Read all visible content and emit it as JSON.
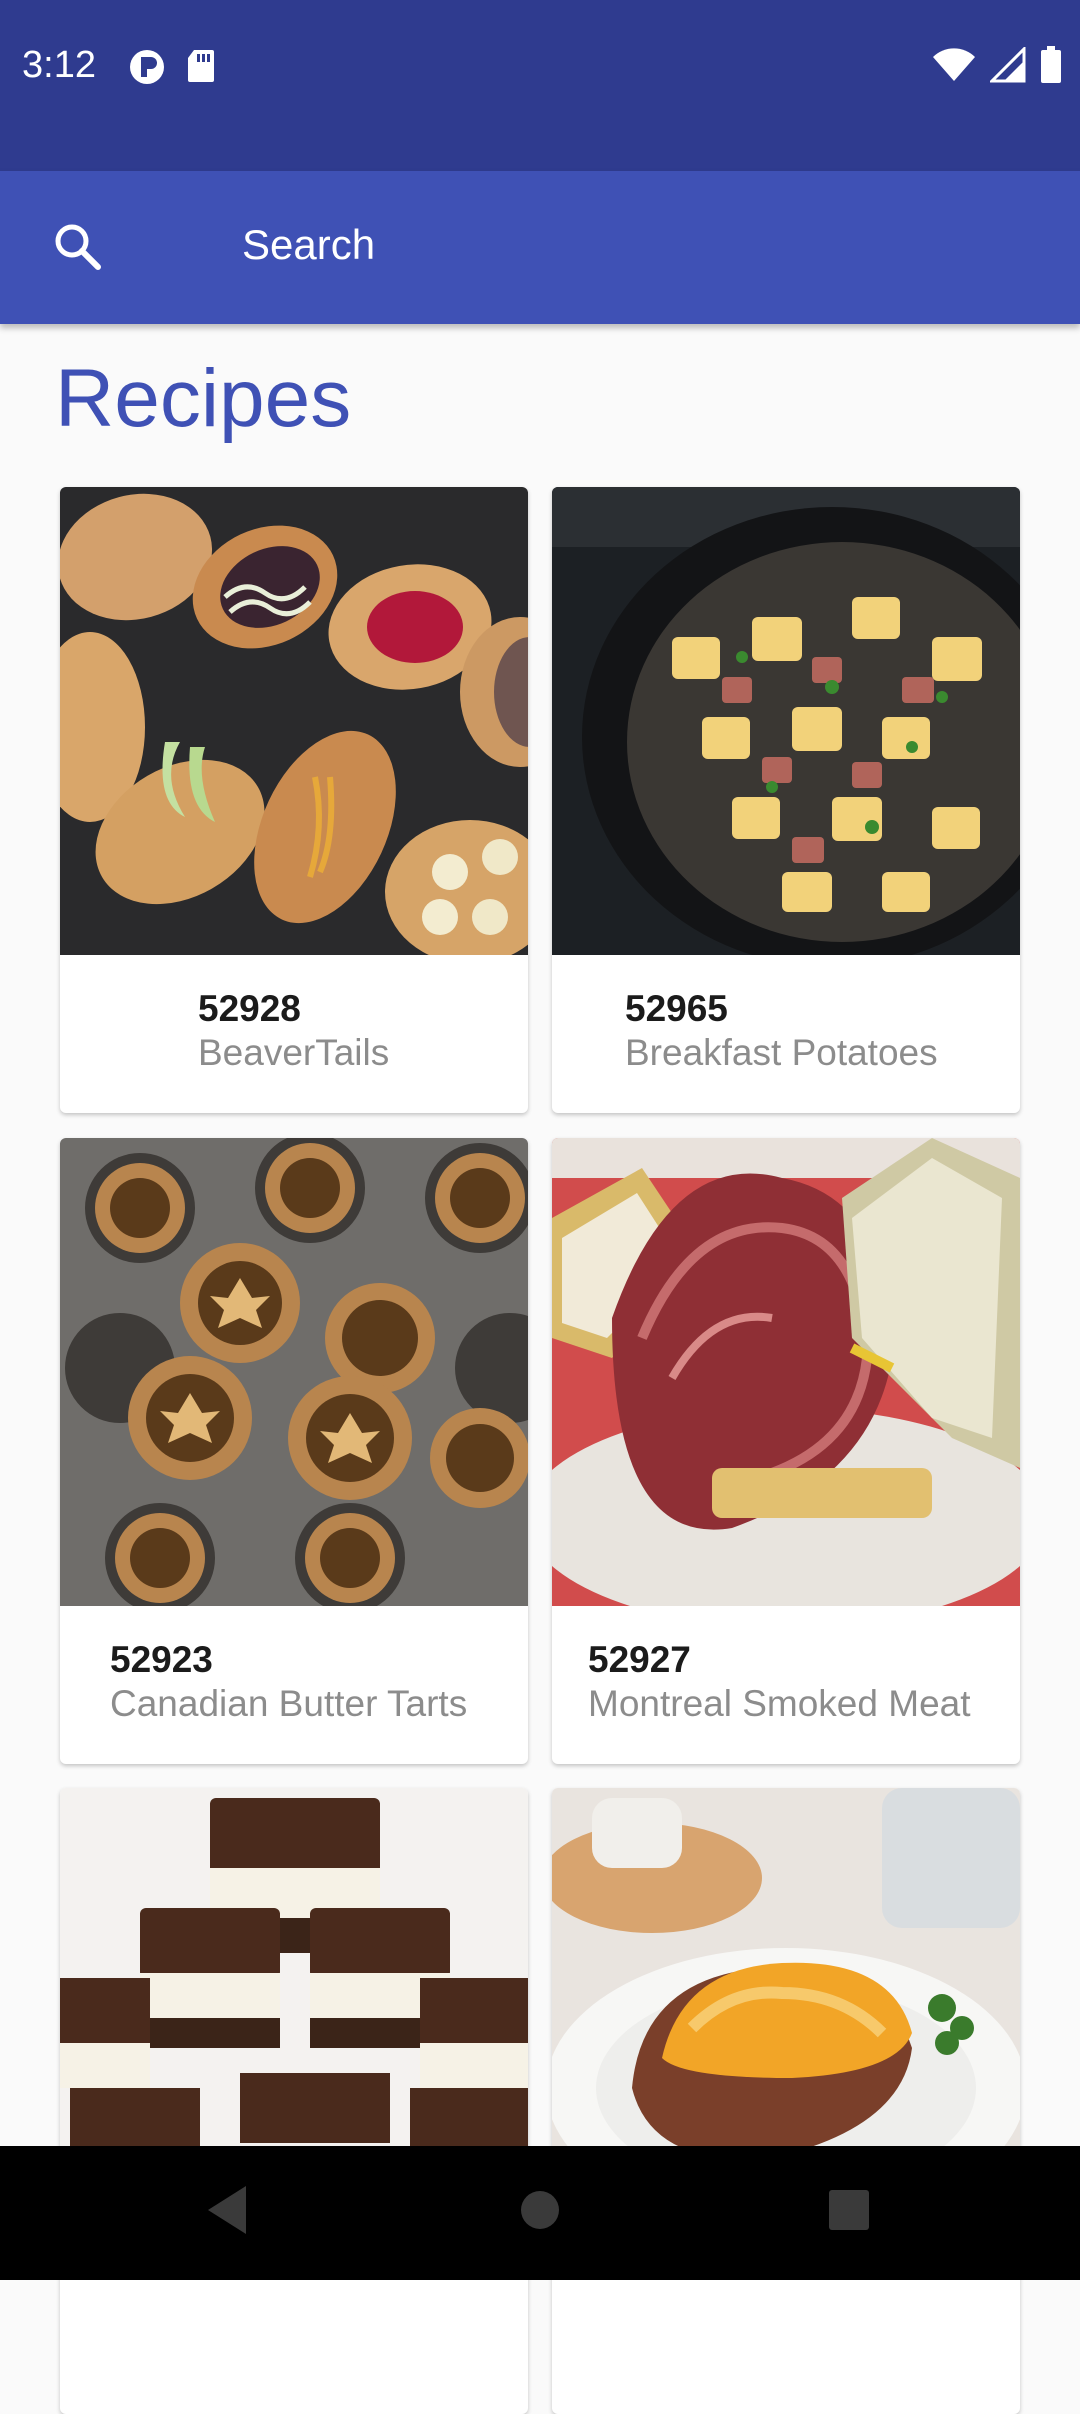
{
  "status_bar": {
    "time": "3:12",
    "left_icons": [
      "app-notification-icon",
      "sd-card-icon"
    ],
    "right_icons": [
      "wifi-icon",
      "cell-signal-icon",
      "battery-icon"
    ]
  },
  "search": {
    "label": "Search"
  },
  "page": {
    "title": "Recipes"
  },
  "recipes": [
    {
      "id": "52928",
      "name": "BeaverTails",
      "image": "beavertails-photo"
    },
    {
      "id": "52965",
      "name": "Breakfast Potatoes",
      "image": "breakfast-potatoes-photo"
    },
    {
      "id": "52923",
      "name": "Canadian Butter Tarts",
      "image": "butter-tarts-photo"
    },
    {
      "id": "52927",
      "name": "Montreal Smoked Meat",
      "image": "smoked-meat-photo"
    },
    {
      "image": "nanaimo-bars-photo"
    },
    {
      "image": "shepherds-pie-photo"
    }
  ],
  "nav_bar": {
    "buttons": [
      "back-icon",
      "home-icon",
      "recents-icon"
    ]
  },
  "colors": {
    "status_bar": "#2f3b8f",
    "app_bar": "#3f51b5",
    "accent": "#3f51b5"
  }
}
